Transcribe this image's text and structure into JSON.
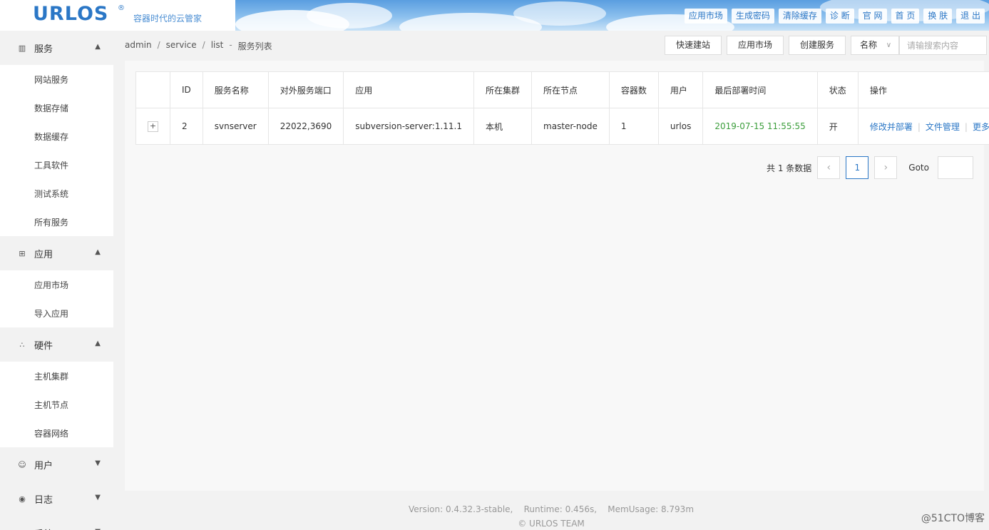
{
  "header": {
    "logo": "URLOS",
    "logo_mark": "®",
    "slogan": "容器时代的云管家",
    "nav": [
      "应用市场",
      "生成密码",
      "清除缓存",
      "诊 断",
      "官 网",
      "首 页",
      "换 肤",
      "退 出"
    ]
  },
  "sidebar": {
    "groups": [
      {
        "label": "服务",
        "icon": "grid-icon",
        "expanded": true,
        "items": [
          "网站服务",
          "数据存储",
          "数据缓存",
          "工具软件",
          "测试系统",
          "所有服务"
        ]
      },
      {
        "label": "应用",
        "icon": "apps-icon",
        "expanded": true,
        "items": [
          "应用市场",
          "导入应用"
        ]
      },
      {
        "label": "硬件",
        "icon": "share-icon",
        "expanded": true,
        "items": [
          "主机集群",
          "主机节点",
          "容器网络"
        ]
      },
      {
        "label": "用户",
        "icon": "user-icon",
        "expanded": false,
        "items": []
      },
      {
        "label": "日志",
        "icon": "eye-icon",
        "expanded": false,
        "items": []
      },
      {
        "label": "系统",
        "icon": "gear-icon",
        "expanded": false,
        "items": []
      }
    ]
  },
  "breadcrumb": {
    "parts": [
      "admin",
      "service",
      "list"
    ],
    "title": "服务列表"
  },
  "toolbar": {
    "quick_site": "快速建站",
    "app_market": "应用市场",
    "create_service": "创建服务",
    "select_value": "名称",
    "search_placeholder": "请输搜索内容"
  },
  "table": {
    "headers": [
      "",
      "ID",
      "服务名称",
      "对外服务端口",
      "应用",
      "所在集群",
      "所在节点",
      "容器数",
      "用户",
      "最后部署时间",
      "状态",
      "操作"
    ],
    "rows": [
      {
        "expand": "+",
        "id": "2",
        "name": "svnserver",
        "ports": "22022,3690",
        "app": "subversion-server:1.11.1",
        "cluster": "本机",
        "node": "master-node",
        "containers": "1",
        "user": "urlos",
        "deployed": "2019-07-15 11:55:55",
        "status": "开",
        "ops": [
          "修改并部署",
          "文件管理",
          "更多"
        ]
      }
    ]
  },
  "pager": {
    "total": "共 1 条数据",
    "current": "1",
    "goto_label": "Goto"
  },
  "footer": {
    "line1": "Version: 0.4.32.3-stable,    Runtime: 0.456s,    MemUsage: 8.793m",
    "line2": "© URLOS TEAM"
  },
  "watermark": "@51CTO博客"
}
